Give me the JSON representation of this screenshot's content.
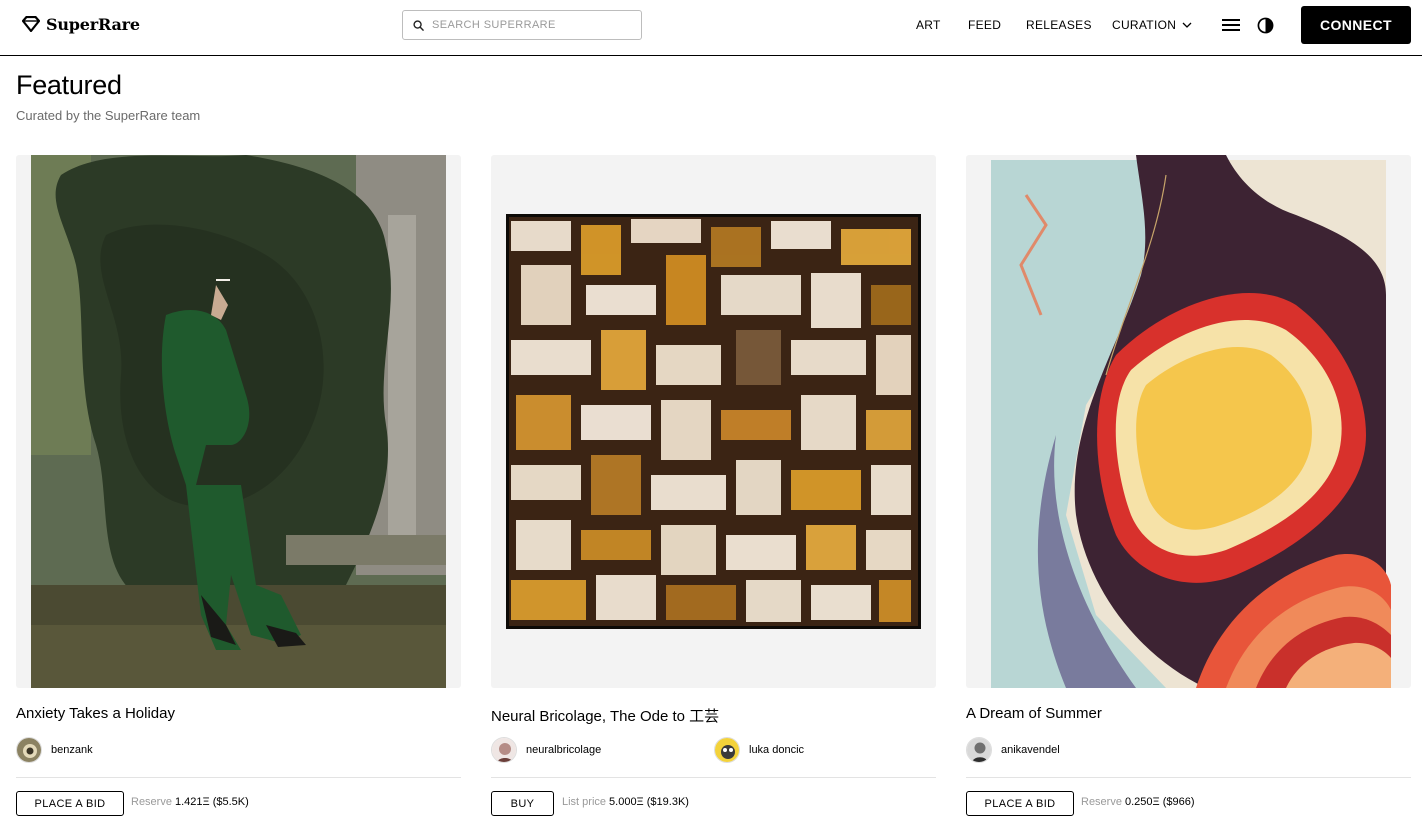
{
  "header": {
    "logo_text": "SuperRare",
    "search_placeholder": "SEARCH SUPERRARE",
    "nav": {
      "art": "ART",
      "feed": "FEED",
      "releases": "RELEASES",
      "curation": "CURATION"
    },
    "connect_label": "CONNECT"
  },
  "section": {
    "title": "Featured",
    "subtitle": "Curated by the SuperRare team"
  },
  "cards": [
    {
      "title": "Anxiety Takes a Holiday",
      "artists": [
        "benzank"
      ],
      "action_label": "PLACE A BID",
      "price_label": "Reserve",
      "price_value": "1.421Ξ ($5.5K)"
    },
    {
      "title": "Neural Bricolage, The Ode to 工芸",
      "artists": [
        "neuralbricolage",
        "luka doncic"
      ],
      "action_label": "BUY",
      "price_label": "List price",
      "price_value": "5.000Ξ ($19.3K)"
    },
    {
      "title": "A Dream of Summer",
      "artists": [
        "anikavendel"
      ],
      "action_label": "PLACE A BID",
      "price_label": "Reserve",
      "price_value": "0.250Ξ ($966)"
    }
  ]
}
